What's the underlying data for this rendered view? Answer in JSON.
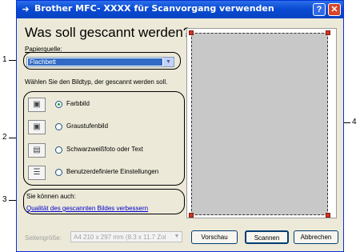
{
  "window": {
    "title_brand": "Brother MFC-",
    "title_model": "XXXX",
    "title_suffix": "für Scanvorgang verwenden",
    "help_icon": "question-icon",
    "close_icon": "close-icon"
  },
  "heading": "Was soll gescannt werden?",
  "source": {
    "label": "Papierquelle:",
    "value": "Flachbett"
  },
  "image_type_prompt": "Wählen Sie den Bildtyp, der gescannt werden soll.",
  "options": [
    {
      "label": "Farbbild",
      "selected": true,
      "icon": "color-picture-icon"
    },
    {
      "label": "Graustufenbild",
      "selected": false,
      "icon": "grayscale-picture-icon"
    },
    {
      "label": "Schwarzweißfoto oder Text",
      "selected": false,
      "icon": "black-white-text-icon"
    },
    {
      "label": "Benutzerdefinierte Einstellungen",
      "selected": false,
      "icon": "custom-settings-icon"
    }
  ],
  "also": {
    "label": "Sie können auch:",
    "link": "Qualität des gescannten Bildes verbessern"
  },
  "page_size": {
    "label": "Seitengröße:",
    "value": "A4 210 x 297 mm (8.3 x 11.7 Zol"
  },
  "buttons": {
    "preview": "Vorschau",
    "scan": "Scannen",
    "cancel": "Abbrechen"
  },
  "callouts": [
    "1",
    "2",
    "3",
    "4"
  ],
  "colors": {
    "title_bar": "#0a4bd4",
    "window_bg": "#ece9d8",
    "selection": "#316ac5",
    "handle": "#d9321f"
  }
}
